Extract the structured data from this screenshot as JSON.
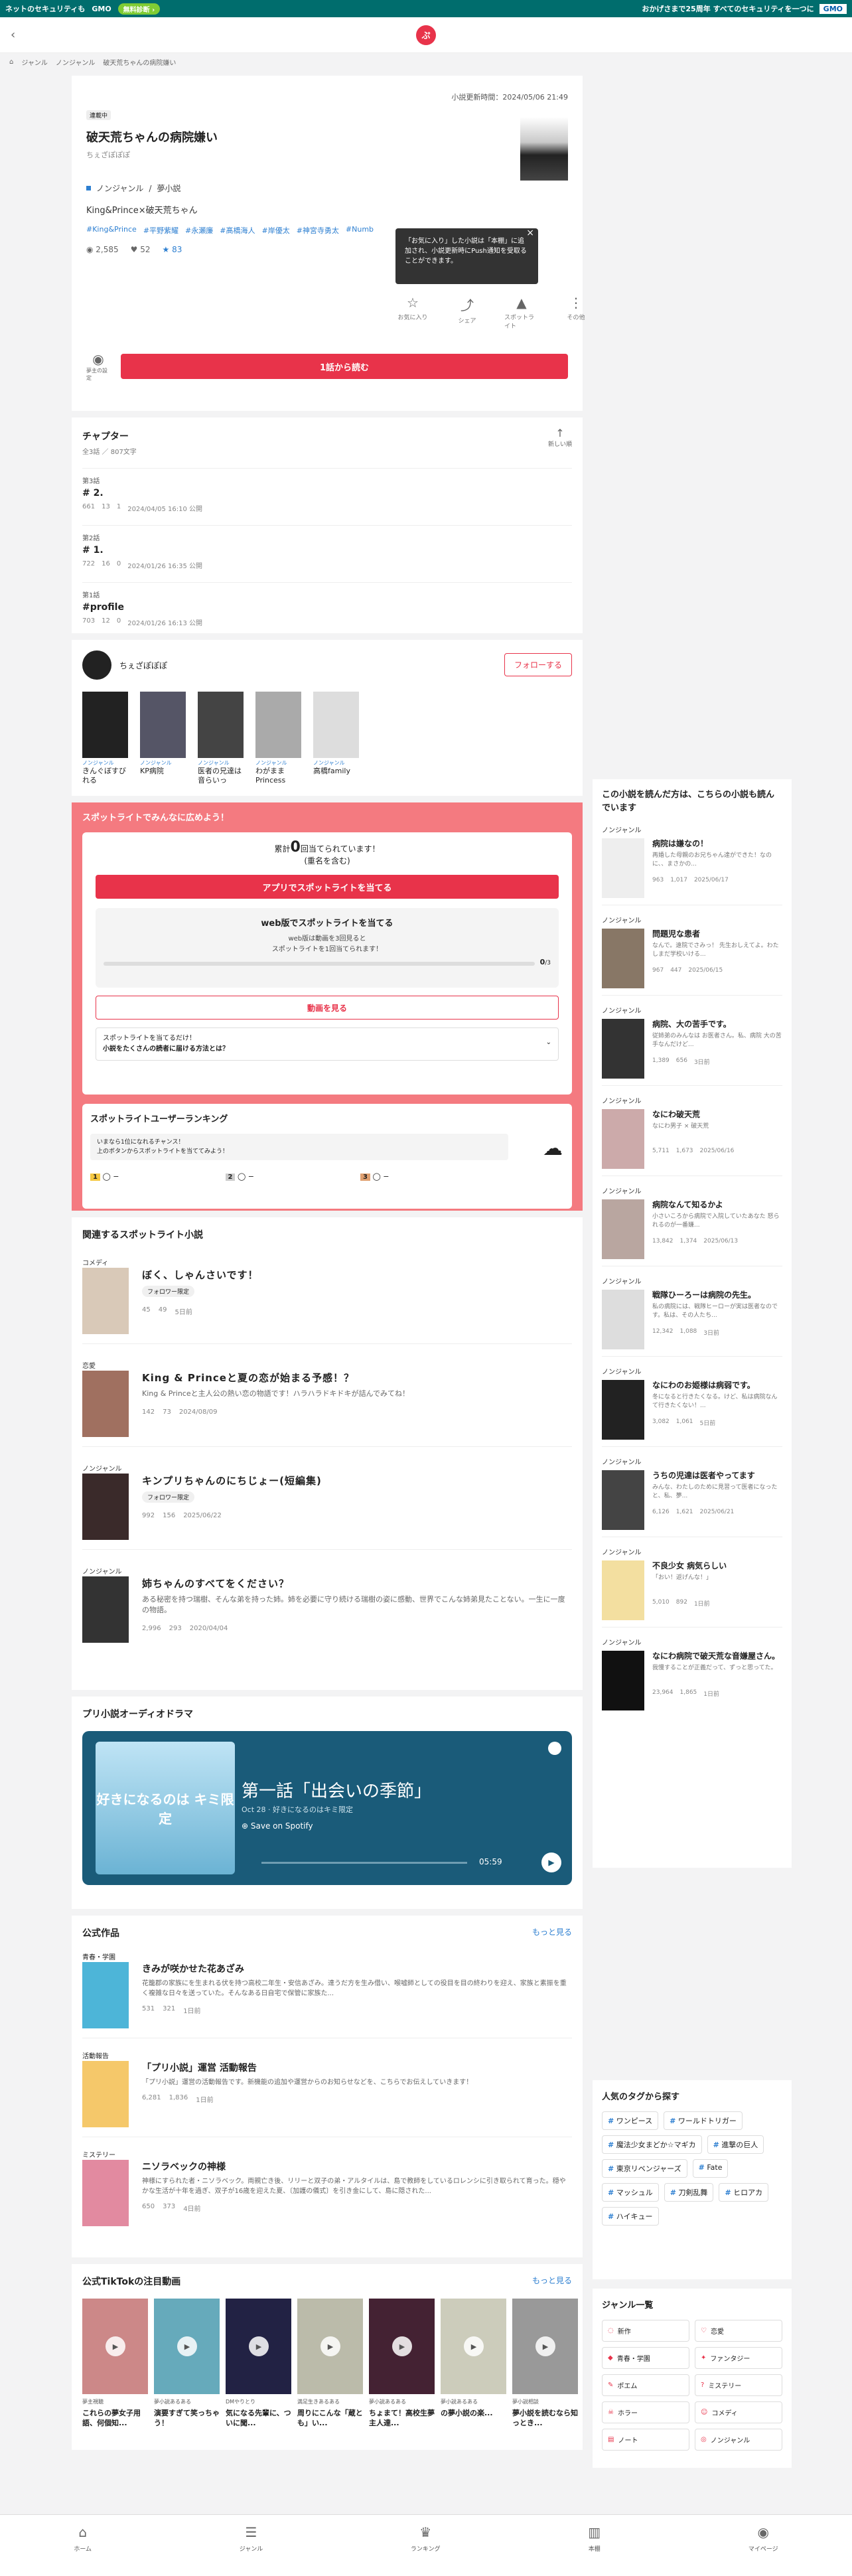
{
  "banner": {
    "text1": "ネットのセキュリティも",
    "brand": "GMO",
    "btn": "無料診断 ›",
    "right": "おかげさまで25周年 すべてのセキュリティを一つに",
    "gmo": "GMO"
  },
  "header": {
    "back": "‹",
    "logo": "ぷ"
  },
  "crumbs": [
    "⌂",
    "ジャンル",
    "ノンジャンル",
    "破天荒ちゃんの病院嫌い"
  ],
  "work": {
    "updated": "小説更新時間：2024/05/06 21:49",
    "badge": "連載中",
    "title": "破天荒ちゃんの病院嫌い",
    "author": "ちぇざぽぽぽ",
    "genre": "ノンジャンル",
    "genre2": "夢小説",
    "summary": "King&Prince×破天荒ちゃん",
    "tags": [
      "#King&Prince",
      "#平野紫耀",
      "#永瀬廉",
      "#髙橋海人",
      "#岸優太",
      "#神宮寺勇太",
      "#Numb"
    ],
    "views": "2,585",
    "stars": "52",
    "hearts": "83",
    "tooltip": "「お気に入り」した小説は「本棚」に追加され、小説更新時にPush通知を受取ることができます。",
    "tooltip_close": "×",
    "actions": [
      {
        "icon": "☆",
        "label": "お気に入り"
      },
      {
        "icon": "⤴",
        "label": "シェア"
      },
      {
        "icon": "▲",
        "label": "スポットライト"
      },
      {
        "icon": "⋮",
        "label": "その他"
      }
    ],
    "fav_label": "夢主の設定",
    "read": "1話から読む"
  },
  "chapters": {
    "title": "チャプター",
    "sub": "全3話 ／ 807文字",
    "new": "新しい順",
    "items": [
      {
        "no": "第3話",
        "title": "# 2.",
        "views": "661",
        "stars": "13",
        "comments": "1",
        "date": "2024/04/05 16:10 公開"
      },
      {
        "no": "第2話",
        "title": "# 1.",
        "views": "722",
        "stars": "16",
        "comments": "0",
        "date": "2024/01/26 16:35 公開"
      },
      {
        "no": "第1話",
        "title": "#profile",
        "views": "703",
        "stars": "12",
        "comments": "0",
        "date": "2024/01/26 16:13 公開"
      }
    ]
  },
  "writer": {
    "name": "ちぇざぽぽぽ",
    "follow": "フォローする",
    "works": [
      {
        "genre": "ノンジャンル",
        "name": "きんぐぼすびれる"
      },
      {
        "genre": "ノンジャンル",
        "name": "KP病院"
      },
      {
        "genre": "ノンジャンル",
        "name": "医者の兄達は音らいっ"
      },
      {
        "genre": "ノンジャンル",
        "name": "わがまま Princess"
      },
      {
        "genre": "ノンジャンル",
        "name": "高橋family"
      }
    ]
  },
  "spotlight": {
    "title": "スポットライトでみんなに広めよう！",
    "count_pre": "累計",
    "count": "0",
    "count_post": "回当てられています！",
    "count_note": "(重名を含む)",
    "app_btn": "アプリでスポットライトを当てる",
    "web_title": "web版でスポットライトを当てる",
    "web_desc1": "web版は動画を3回見ると",
    "web_desc2": "スポットライトを1回当てられます！",
    "progress": "0",
    "progress_max": "/3",
    "ad_btn": "動画を見る",
    "faq1": "スポットライトを当てるだけ！",
    "faq2": "小説をたくさんの読者に届ける方法とは？",
    "rank_title": "スポットライトユーザーランキング",
    "rank_b1": "いまなら1位になれるチャンス！",
    "rank_b2": "上のボタンからスポットライトを当ててみよう！",
    "ranks": [
      "1",
      "2",
      "3"
    ],
    "dash": "−"
  },
  "related": {
    "title": "関連するスポットライト小説",
    "items": [
      {
        "genre": "コメディ",
        "title": "ぼく、しゃんさいです！",
        "pill": "フォロワー限定",
        "desc": "",
        "hearts": "45",
        "stars": "49",
        "date": "5日前"
      },
      {
        "genre": "恋愛",
        "title": "King & Princeと夏の恋が始まる予感！？",
        "pill": "",
        "desc": "King & Princeと主人公の熱い恋の物語です！ハラハラドキドキが詰んでみてね！",
        "hearts": "142",
        "stars": "73",
        "date": "2024/08/09"
      },
      {
        "genre": "ノンジャンル",
        "title": "キンプリちゃんのにちじょー(短編集)",
        "pill": "フォロワー限定",
        "desc": "",
        "hearts": "992",
        "stars": "156",
        "date": "2025/06/22"
      },
      {
        "genre": "ノンジャンル",
        "title": "姉ちゃんのすべてをください？",
        "pill": "",
        "desc": "ある秘密を持つ瑞樹、そんな弟を持った姉。姉を必要に守り続ける瑞樹の姿に感動、世界でこんな姉弟見たことない。一生に一度の物語。",
        "hearts": "2,996",
        "stars": "293",
        "date": "2020/04/04"
      }
    ]
  },
  "audio": {
    "title": "プリ小説オーディオドラマ",
    "art": "好きになるのは キミ限定",
    "ep": "第一話「出会いの季節」",
    "sub": "Oct 28 · 好きになるのはキミ限定",
    "save": "⊕ Save on Spotify",
    "time": "05:59",
    "play": "▶"
  },
  "official": {
    "title": "公式作品",
    "more": "もっと見る",
    "items": [
      {
        "genre": "青春・学園",
        "title": "きみが咲かせた花あざみ",
        "desc": "花籠郡の家族にを生まれる伏を持つ高校二年生・安信あざみ。達うだ方を生み借い、喉嘘師としての役目を目の終わりを迎え、家族と素振を重く複雑な日々を送っていた。そんなある日自宅で保管に家族た...",
        "hearts": "531",
        "stars": "321",
        "date": "1日前"
      },
      {
        "genre": "活動報告",
        "title": "「プリ小説」運営 活動報告",
        "desc": "「プリ小説」運営の活動報告です。新機能の追加や運営からのお知らせなどを、こちらでお伝えしていきます！",
        "hearts": "6,281",
        "stars": "1,836",
        "date": "1日前"
      },
      {
        "genre": "ミステリー",
        "title": "ニソラベックの神様",
        "desc": "神様にすられた者・ニソラベック。両親亡き後、リリーと双子の弟・アルタイルは、島で教師をしているロレンシに引き取られて育った。穏やかな生活が十年を過ぎ、双子が16歳を迎えた夏、〔加護の儀式〕を引き金にして、島に隠された...",
        "hearts": "650",
        "stars": "373",
        "date": "4日前"
      }
    ]
  },
  "tiktok": {
    "title": "公式TikTokの注目動画",
    "more": "もっと見る",
    "play": "▶",
    "vids": [
      {
        "user": "夢主視聴",
        "cap": "これらの夢女子用語、何個知..."
      },
      {
        "user": "夢小説あるある",
        "cap": "演要すぎて笑っちゃう！"
      },
      {
        "user": "DMやりとり",
        "cap": "気になる先輩に、ついに聞..."
      },
      {
        "user": "満足生きあるある",
        "cap": "周りにこんな「蔵とも」い..."
      },
      {
        "user": "夢小説あるある",
        "cap": "ちょまて！高校生夢主人達..."
      },
      {
        "user": "夢小説あるある",
        "cap": "の夢小説の楽..."
      },
      {
        "user": "夢小説相談",
        "cap": "夢小説を読むなら知っとき..."
      }
    ]
  },
  "recommend": {
    "title": "この小説を読んだ方は、こちらの小説も読んでいます",
    "items": [
      {
        "genre": "ノンジャンル",
        "title": "病院は嫌なの！",
        "desc": "再婚した母親のお兄ちゃん達ができた！なのに、、まさかの...",
        "h": "963",
        "s": "1,017",
        "d": "2025/06/17"
      },
      {
        "genre": "ノンジャンル",
        "title": "問題児な患者",
        "desc": "なんで。遠院でさみっ！ 先生おしえてよ。わたしまだ学校いける...",
        "h": "967",
        "s": "447",
        "d": "2025/06/15"
      },
      {
        "genre": "ノンジャンル",
        "title": "病院、大の苦手です。",
        "desc": "従姉弟のみんなは お医者さん。私、病院 大の苦手なんだけど...",
        "h": "1,389",
        "s": "656",
        "d": "3日前"
      },
      {
        "genre": "ノンジャンル",
        "title": "なにわ破天荒",
        "desc": "なにわ男子 × 破天荒",
        "h": "5,711",
        "s": "1,673",
        "d": "2025/06/16"
      },
      {
        "genre": "ノンジャンル",
        "title": "病院なんて知るかよ",
        "desc": "小さいころから病院で入院していたあなた 怒られるのが一番嫌...",
        "h": "13,842",
        "s": "1,374",
        "d": "2025/06/13"
      },
      {
        "genre": "ノンジャンル",
        "title": "戦隊ひーろーは病院の先生。",
        "desc": "私の病院には、戦隊ヒーローが実は医者なのです。私は、その人たち...",
        "h": "12,342",
        "s": "1,088",
        "d": "3日前"
      },
      {
        "genre": "ノンジャンル",
        "title": "なにわのお姫様は病弱です。",
        "desc": "冬になると行きたくなる。けど、私は病院なんて行きたくない！...",
        "h": "3,082",
        "s": "1,061",
        "d": "5日前"
      },
      {
        "genre": "ノンジャンル",
        "title": "うちの児達は医者やってます",
        "desc": "みんな、わたしのために見習って医者になったと、私、夢...",
        "h": "6,126",
        "s": "1,621",
        "d": "2025/06/21"
      },
      {
        "genre": "ノンジャンル",
        "title": "不良少女 病気らしい",
        "desc": "「おい！返げんな！」",
        "h": "5,010",
        "s": "892",
        "d": "1日前"
      },
      {
        "genre": "ノンジャンル",
        "title": "なにわ病院で破天荒な音嫌屋さん。",
        "desc": "我慢することが正義だって、ずっと思ってた。",
        "h": "23,964",
        "s": "1,865",
        "d": "1日前"
      }
    ]
  },
  "tags_popular": {
    "title": "人気のタグから探す",
    "items": [
      "ワンピース",
      "ワールドトリガー",
      "魔法少女まどか☆マギカ",
      "進撃の巨人",
      "東京リベンジャーズ",
      "Fate",
      "マッシュル",
      "刀剣乱舞",
      "ヒロアカ",
      "ハイキュー"
    ]
  },
  "genres": {
    "title": "ジャンル一覧",
    "items": [
      "新作",
      "恋愛",
      "青春・学園",
      "ファンタジー",
      "ポエム",
      "ミステリー",
      "ホラー",
      "コメディ",
      "ノート",
      "ノンジャンル"
    ]
  },
  "tabbar": [
    {
      "icon": "⌂",
      "label": "ホーム"
    },
    {
      "icon": "☰",
      "label": "ジャンル"
    },
    {
      "icon": "♛",
      "label": "ランキング"
    },
    {
      "icon": "▥",
      "label": "本棚"
    },
    {
      "icon": "◉",
      "label": "マイページ"
    }
  ]
}
